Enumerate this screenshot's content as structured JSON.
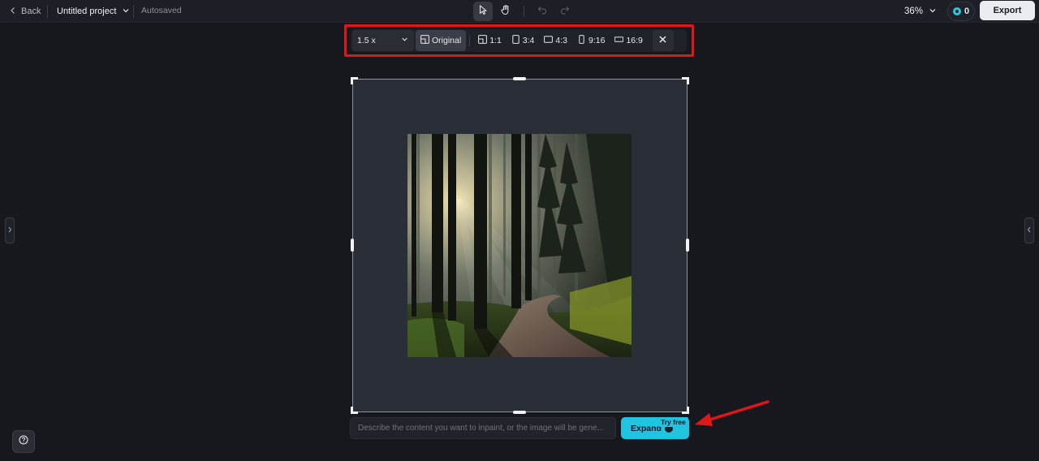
{
  "header": {
    "back_label": "Back",
    "project_title": "Untitled project",
    "autosaved": "Autosaved",
    "zoom": "36%",
    "credits": "0",
    "export_label": "Export"
  },
  "ratio_toolbar": {
    "scale": "1.5 x",
    "options": [
      "Original",
      "1:1",
      "3:4",
      "4:3",
      "9:16",
      "16:9"
    ],
    "selected": "Original"
  },
  "prompt": {
    "placeholder": "Describe the content you want to inpaint, or the image will be gene...",
    "value": ""
  },
  "expand_button": {
    "label": "Expand",
    "badge": "Try free"
  },
  "icons": {
    "select_tool": "cursor-icon",
    "pan_tool": "hand-icon",
    "undo": "undo-icon",
    "redo": "redo-icon",
    "help": "help-icon"
  },
  "colors": {
    "accent": "#1fc4df",
    "highlight": "#e0161b",
    "background": "#16181d"
  }
}
